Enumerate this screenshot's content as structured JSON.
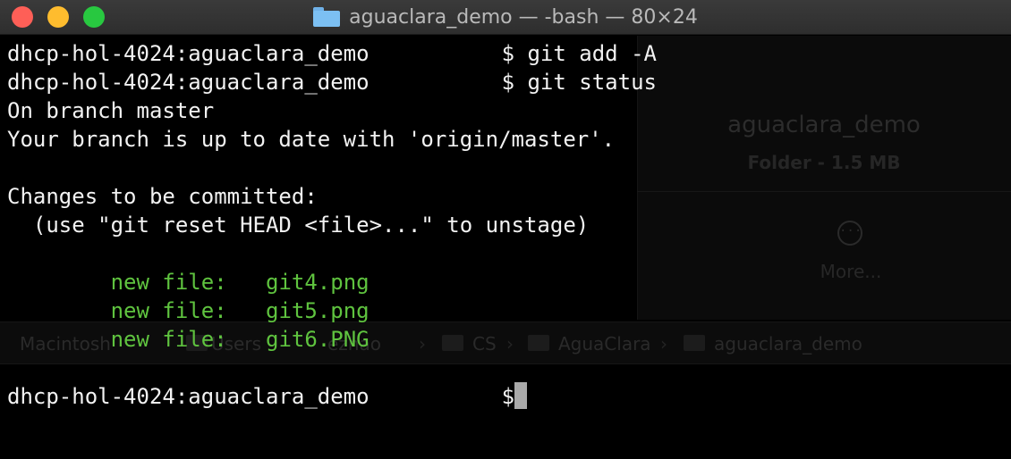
{
  "window": {
    "title": "aguaclara_demo — -bash — 80×24"
  },
  "finder_ghost": {
    "folder_name": "aguaclara_demo",
    "folder_info": "Folder - 1.5 MB",
    "more_label": "More...",
    "path": [
      "Macintosh",
      "Users",
      "ezhao",
      "CS",
      "AguaClara",
      "aguaclara_demo"
    ]
  },
  "terminal": {
    "prompt": "dhcp-hol-4024:aguaclara_demo",
    "prompt_symbol": "$",
    "commands": [
      "git add -A",
      "git status"
    ],
    "output": {
      "branch_line": "On branch master",
      "uptodate_line": "Your branch is up to date with 'origin/master'.",
      "changes_header": "Changes to be committed:",
      "hint_line": "  (use \"git reset HEAD <file>...\" to unstage)",
      "new_file_label": "new file:",
      "files": [
        "git4.png",
        "git5.png",
        "git6.PNG"
      ]
    }
  },
  "colors": {
    "staged_green": "#5fc33f",
    "terminal_bg": "#000000",
    "terminal_fg": "#f2f2f2"
  }
}
